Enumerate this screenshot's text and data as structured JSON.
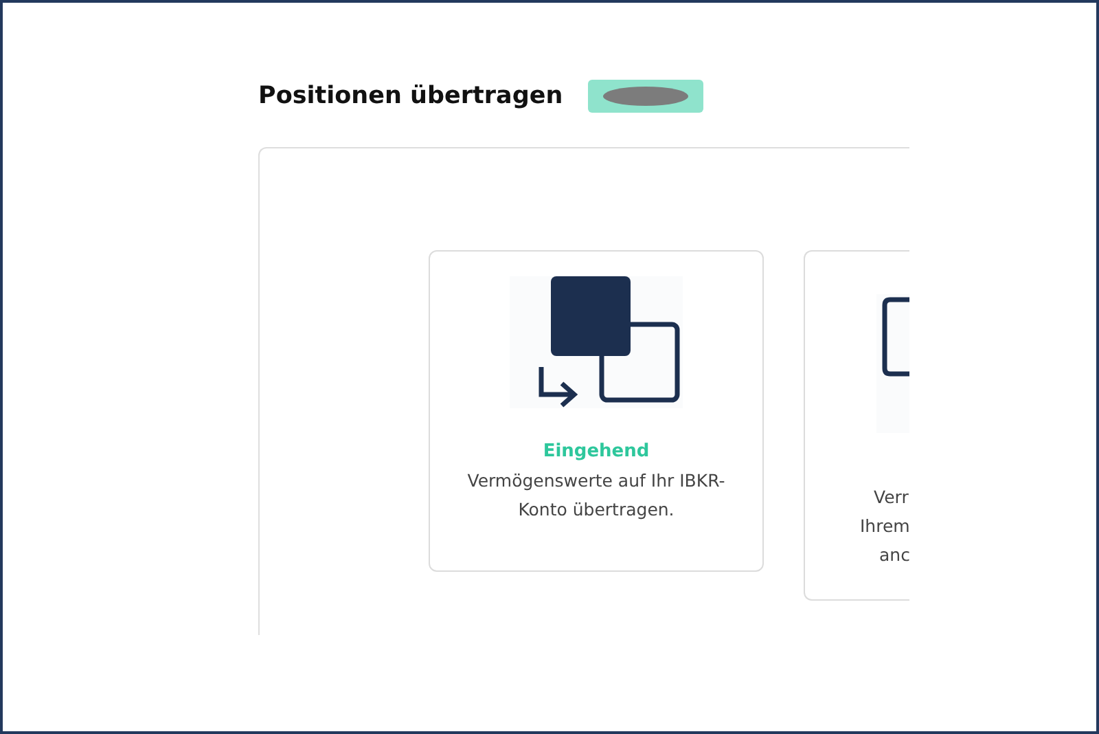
{
  "page": {
    "title": "Positionen übertragen"
  },
  "cards": [
    {
      "kind": "incoming",
      "title": "Eingehend",
      "description": "Vermögenswerte auf Ihr IBKR-Konto übertragen."
    },
    {
      "kind": "clipped",
      "lines": [
        "Verr",
        "Ihrem",
        "anc"
      ]
    }
  ]
}
